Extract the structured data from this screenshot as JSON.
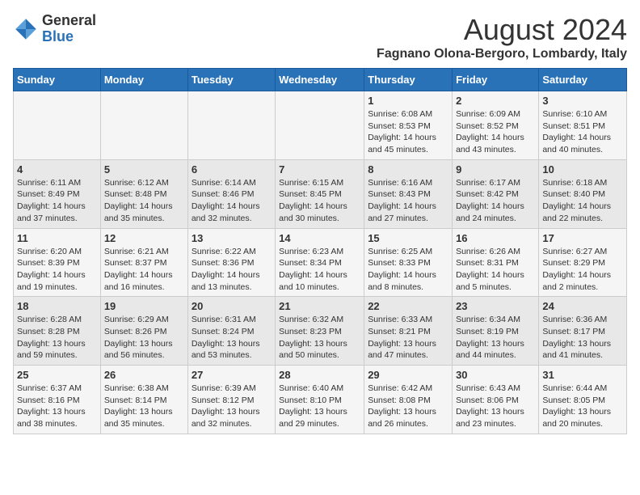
{
  "header": {
    "logo_general": "General",
    "logo_blue": "Blue",
    "main_title": "August 2024",
    "subtitle": "Fagnano Olona-Bergoro, Lombardy, Italy"
  },
  "calendar": {
    "days_of_week": [
      "Sunday",
      "Monday",
      "Tuesday",
      "Wednesday",
      "Thursday",
      "Friday",
      "Saturday"
    ],
    "weeks": [
      [
        {
          "day": "",
          "info": ""
        },
        {
          "day": "",
          "info": ""
        },
        {
          "day": "",
          "info": ""
        },
        {
          "day": "",
          "info": ""
        },
        {
          "day": "1",
          "info": "Sunrise: 6:08 AM\nSunset: 8:53 PM\nDaylight: 14 hours and 45 minutes."
        },
        {
          "day": "2",
          "info": "Sunrise: 6:09 AM\nSunset: 8:52 PM\nDaylight: 14 hours and 43 minutes."
        },
        {
          "day": "3",
          "info": "Sunrise: 6:10 AM\nSunset: 8:51 PM\nDaylight: 14 hours and 40 minutes."
        }
      ],
      [
        {
          "day": "4",
          "info": "Sunrise: 6:11 AM\nSunset: 8:49 PM\nDaylight: 14 hours and 37 minutes."
        },
        {
          "day": "5",
          "info": "Sunrise: 6:12 AM\nSunset: 8:48 PM\nDaylight: 14 hours and 35 minutes."
        },
        {
          "day": "6",
          "info": "Sunrise: 6:14 AM\nSunset: 8:46 PM\nDaylight: 14 hours and 32 minutes."
        },
        {
          "day": "7",
          "info": "Sunrise: 6:15 AM\nSunset: 8:45 PM\nDaylight: 14 hours and 30 minutes."
        },
        {
          "day": "8",
          "info": "Sunrise: 6:16 AM\nSunset: 8:43 PM\nDaylight: 14 hours and 27 minutes."
        },
        {
          "day": "9",
          "info": "Sunrise: 6:17 AM\nSunset: 8:42 PM\nDaylight: 14 hours and 24 minutes."
        },
        {
          "day": "10",
          "info": "Sunrise: 6:18 AM\nSunset: 8:40 PM\nDaylight: 14 hours and 22 minutes."
        }
      ],
      [
        {
          "day": "11",
          "info": "Sunrise: 6:20 AM\nSunset: 8:39 PM\nDaylight: 14 hours and 19 minutes."
        },
        {
          "day": "12",
          "info": "Sunrise: 6:21 AM\nSunset: 8:37 PM\nDaylight: 14 hours and 16 minutes."
        },
        {
          "day": "13",
          "info": "Sunrise: 6:22 AM\nSunset: 8:36 PM\nDaylight: 14 hours and 13 minutes."
        },
        {
          "day": "14",
          "info": "Sunrise: 6:23 AM\nSunset: 8:34 PM\nDaylight: 14 hours and 10 minutes."
        },
        {
          "day": "15",
          "info": "Sunrise: 6:25 AM\nSunset: 8:33 PM\nDaylight: 14 hours and 8 minutes."
        },
        {
          "day": "16",
          "info": "Sunrise: 6:26 AM\nSunset: 8:31 PM\nDaylight: 14 hours and 5 minutes."
        },
        {
          "day": "17",
          "info": "Sunrise: 6:27 AM\nSunset: 8:29 PM\nDaylight: 14 hours and 2 minutes."
        }
      ],
      [
        {
          "day": "18",
          "info": "Sunrise: 6:28 AM\nSunset: 8:28 PM\nDaylight: 13 hours and 59 minutes."
        },
        {
          "day": "19",
          "info": "Sunrise: 6:29 AM\nSunset: 8:26 PM\nDaylight: 13 hours and 56 minutes."
        },
        {
          "day": "20",
          "info": "Sunrise: 6:31 AM\nSunset: 8:24 PM\nDaylight: 13 hours and 53 minutes."
        },
        {
          "day": "21",
          "info": "Sunrise: 6:32 AM\nSunset: 8:23 PM\nDaylight: 13 hours and 50 minutes."
        },
        {
          "day": "22",
          "info": "Sunrise: 6:33 AM\nSunset: 8:21 PM\nDaylight: 13 hours and 47 minutes."
        },
        {
          "day": "23",
          "info": "Sunrise: 6:34 AM\nSunset: 8:19 PM\nDaylight: 13 hours and 44 minutes."
        },
        {
          "day": "24",
          "info": "Sunrise: 6:36 AM\nSunset: 8:17 PM\nDaylight: 13 hours and 41 minutes."
        }
      ],
      [
        {
          "day": "25",
          "info": "Sunrise: 6:37 AM\nSunset: 8:16 PM\nDaylight: 13 hours and 38 minutes."
        },
        {
          "day": "26",
          "info": "Sunrise: 6:38 AM\nSunset: 8:14 PM\nDaylight: 13 hours and 35 minutes."
        },
        {
          "day": "27",
          "info": "Sunrise: 6:39 AM\nSunset: 8:12 PM\nDaylight: 13 hours and 32 minutes."
        },
        {
          "day": "28",
          "info": "Sunrise: 6:40 AM\nSunset: 8:10 PM\nDaylight: 13 hours and 29 minutes."
        },
        {
          "day": "29",
          "info": "Sunrise: 6:42 AM\nSunset: 8:08 PM\nDaylight: 13 hours and 26 minutes."
        },
        {
          "day": "30",
          "info": "Sunrise: 6:43 AM\nSunset: 8:06 PM\nDaylight: 13 hours and 23 minutes."
        },
        {
          "day": "31",
          "info": "Sunrise: 6:44 AM\nSunset: 8:05 PM\nDaylight: 13 hours and 20 minutes."
        }
      ]
    ]
  }
}
